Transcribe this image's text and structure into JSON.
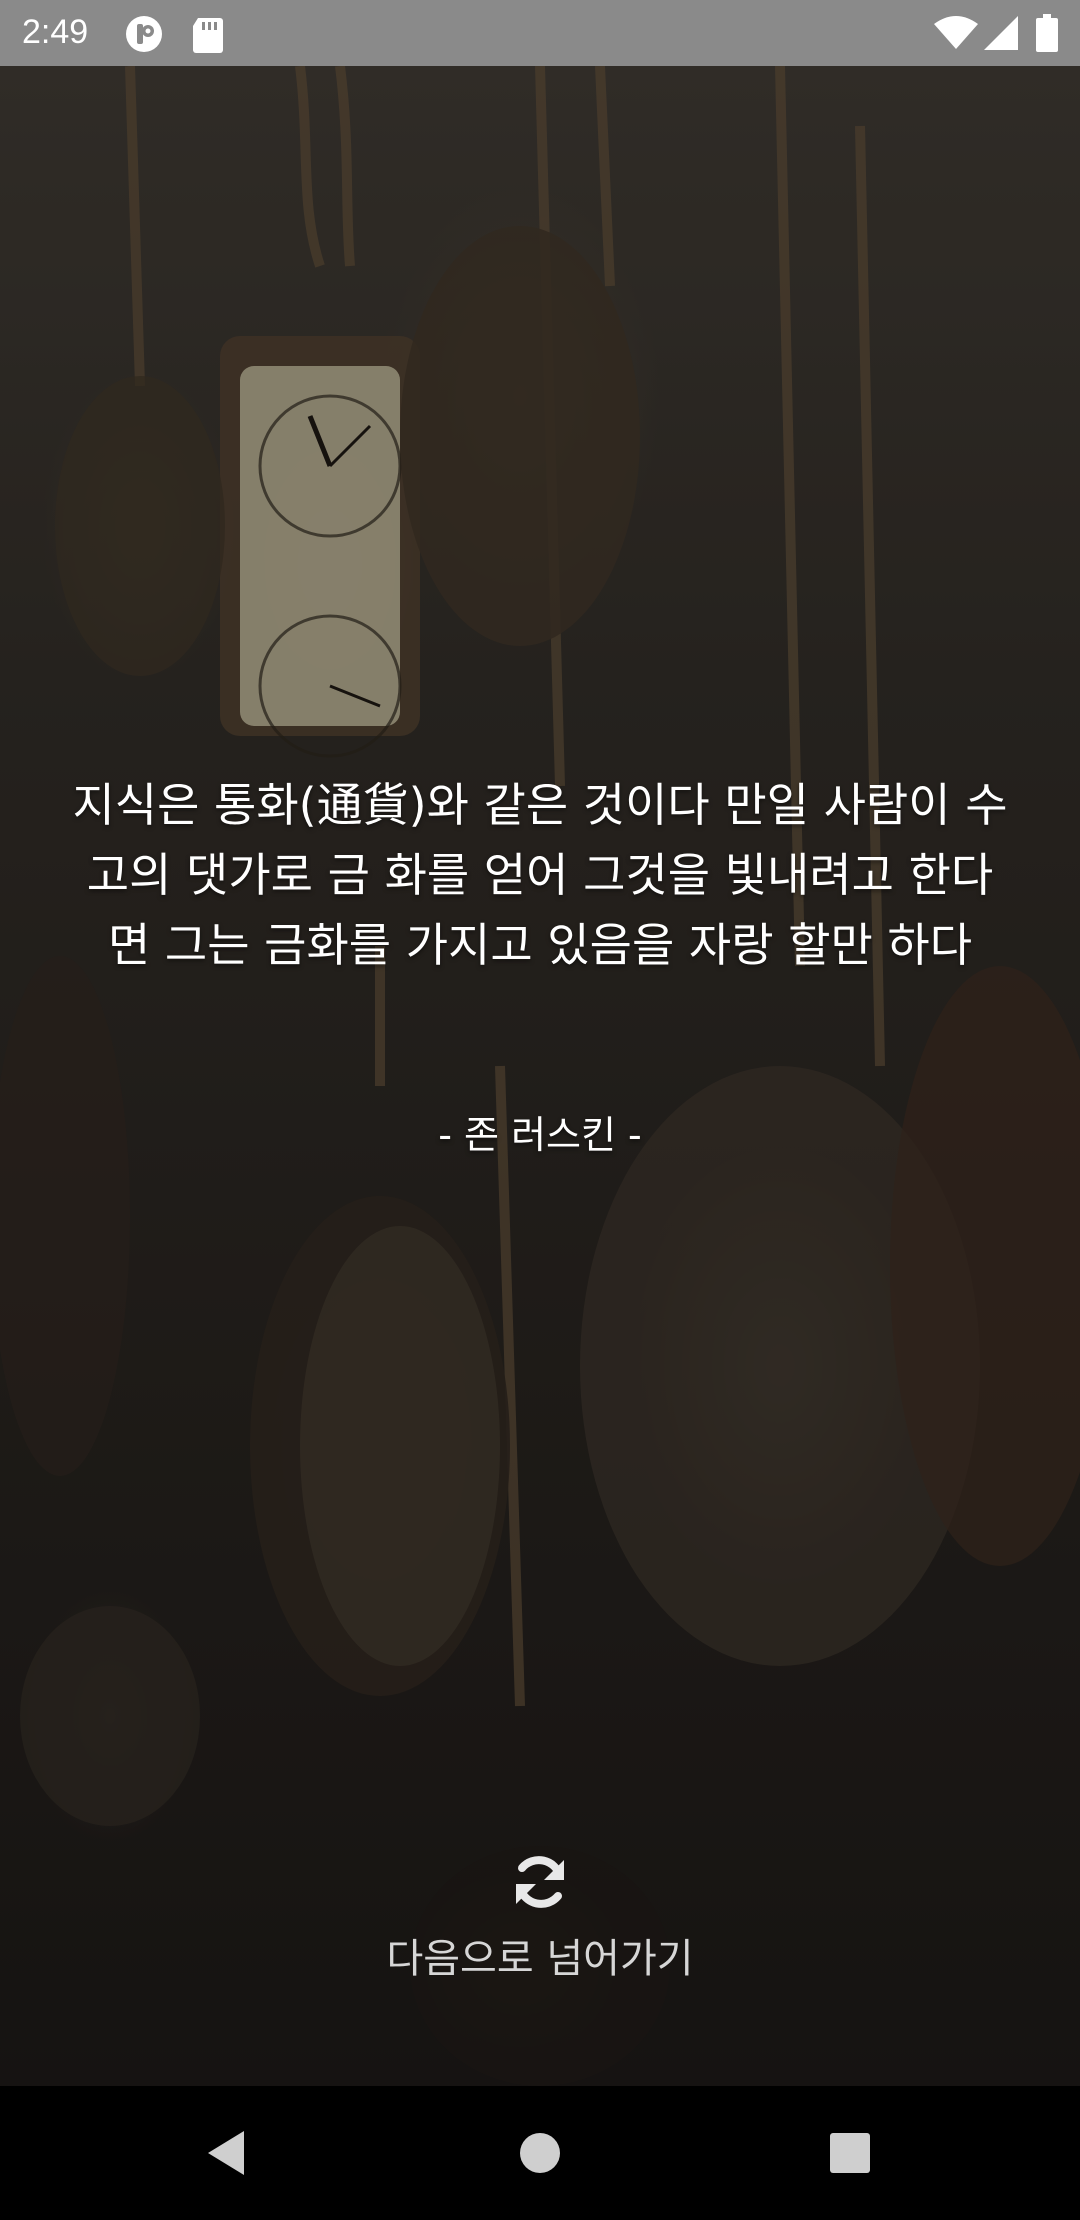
{
  "status_bar": {
    "time": "2:49",
    "left_icons": [
      "assistant-icon",
      "sd-card-icon"
    ],
    "right_icons": [
      "wifi-icon",
      "cell-signal-icon",
      "battery-icon"
    ]
  },
  "quote": {
    "text": "지식은 통화(通貨)와 같은 것이다 만일 사람이 수고의 댓가로 금 화를 얻어 그것을 빛내려고 한다면 그는 금화를 가지고 있음을 자랑 할만 하다",
    "author": "- 존 러스킨 -"
  },
  "next": {
    "icon": "refresh-icon",
    "label": "다음으로 넘어가기"
  },
  "nav_bar": {
    "buttons": [
      "back-icon",
      "home-icon",
      "recents-icon"
    ]
  },
  "colors": {
    "status_bar_bg": "#8a8a8a",
    "text": "#ffffff",
    "next_label": "#d6d6d6",
    "nav_bg": "#000000"
  }
}
